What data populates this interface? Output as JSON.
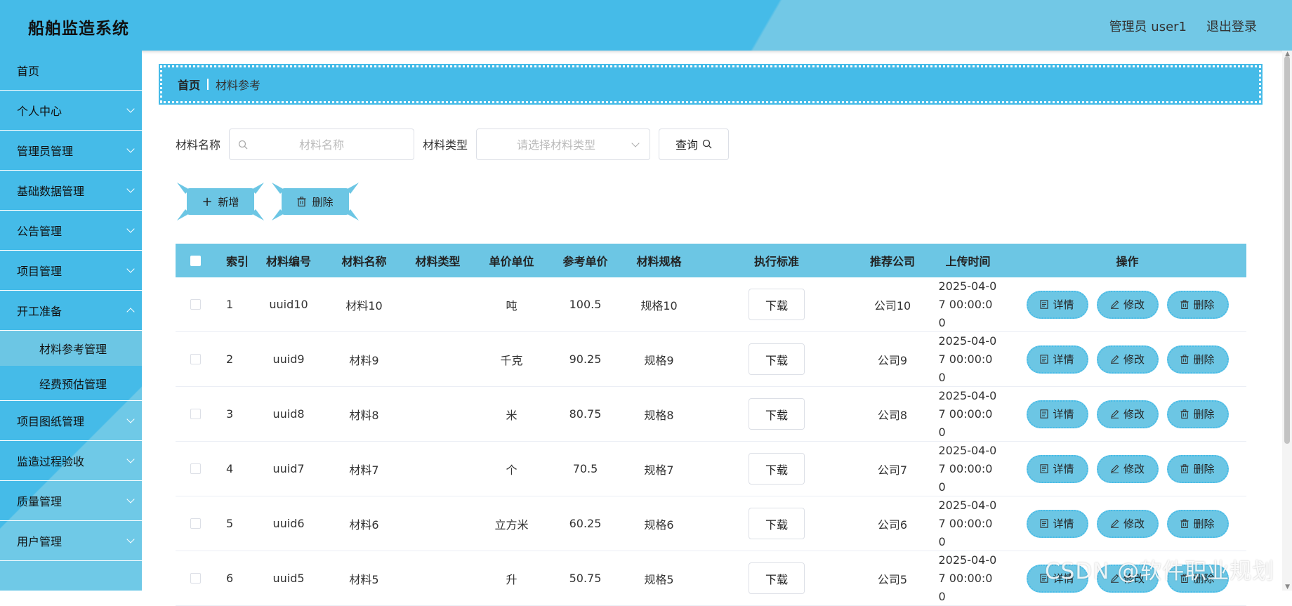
{
  "header": {
    "app_title": "船舶监造系统",
    "user_info": "管理员 user1",
    "logout_label": "退出登录"
  },
  "sidebar": {
    "items": [
      {
        "label": "首页"
      },
      {
        "label": "个人中心"
      },
      {
        "label": "管理员管理"
      },
      {
        "label": "基础数据管理"
      },
      {
        "label": "公告管理"
      },
      {
        "label": "项目管理"
      },
      {
        "label": "开工准备"
      }
    ],
    "sub_items": [
      {
        "label": "材料参考管理"
      },
      {
        "label": "经费预估管理"
      }
    ],
    "items_after": [
      {
        "label": "项目图纸管理"
      },
      {
        "label": "监造过程验收"
      },
      {
        "label": "质量管理"
      },
      {
        "label": "用户管理"
      }
    ]
  },
  "breadcrumb": {
    "home": "首页",
    "current": "材料参考"
  },
  "search": {
    "name_label": "材料名称",
    "name_placeholder": "材料名称",
    "type_label": "材料类型",
    "type_placeholder": "请选择材料类型",
    "query_label": "查询"
  },
  "actions": {
    "add_label": "新增",
    "delete_label": "删除"
  },
  "table": {
    "headers": [
      "索引",
      "材料编号",
      "材料名称",
      "材料类型",
      "单价单位",
      "参考单价",
      "材料规格",
      "执行标准",
      "推荐公司",
      "上传时间",
      "操作"
    ],
    "download_label": "下载",
    "op_labels": {
      "detail": "详情",
      "edit": "修改",
      "delete": "删除"
    },
    "rows": [
      {
        "index": "1",
        "code": "uuid10",
        "name": "材料10",
        "type": "",
        "unit": "吨",
        "price": "100.5",
        "spec": "规格10",
        "company": "公司10",
        "time": "2025-04-07 00:00:00"
      },
      {
        "index": "2",
        "code": "uuid9",
        "name": "材料9",
        "type": "",
        "unit": "千克",
        "price": "90.25",
        "spec": "规格9",
        "company": "公司9",
        "time": "2025-04-07 00:00:00"
      },
      {
        "index": "3",
        "code": "uuid8",
        "name": "材料8",
        "type": "",
        "unit": "米",
        "price": "80.75",
        "spec": "规格8",
        "company": "公司8",
        "time": "2025-04-07 00:00:00"
      },
      {
        "index": "4",
        "code": "uuid7",
        "name": "材料7",
        "type": "",
        "unit": "个",
        "price": "70.5",
        "spec": "规格7",
        "company": "公司7",
        "time": "2025-04-07 00:00:00"
      },
      {
        "index": "5",
        "code": "uuid6",
        "name": "材料6",
        "type": "",
        "unit": "立方米",
        "price": "60.25",
        "spec": "规格6",
        "company": "公司6",
        "time": "2025-04-07 00:00:00"
      },
      {
        "index": "6",
        "code": "uuid5",
        "name": "材料5",
        "type": "",
        "unit": "升",
        "price": "50.75",
        "spec": "规格5",
        "company": "公司5",
        "time": "2025-04-07 00:00:00"
      }
    ]
  },
  "watermark": "CSDN @软件职业规划",
  "colors": {
    "primary": "#45bbe8",
    "accent": "#6cc6e4",
    "border": "#dcdfe6"
  }
}
